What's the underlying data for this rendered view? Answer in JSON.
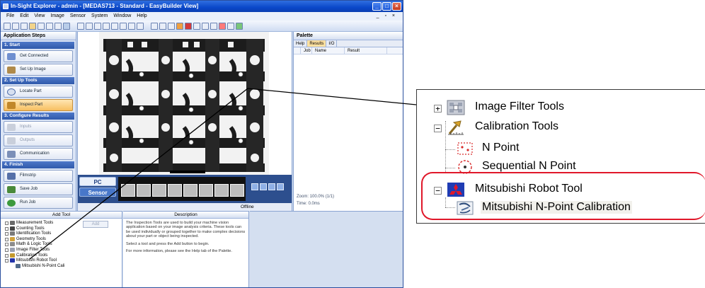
{
  "window": {
    "title": "In-Sight Explorer - admin - [MEDAS713 - Standard - EasyBuilder View]",
    "controls": [
      "_",
      "□",
      "×"
    ]
  },
  "menubar": {
    "items": [
      "File",
      "Edit",
      "View",
      "Image",
      "Sensor",
      "System",
      "Window",
      "Help"
    ],
    "mdi_controls": "_ ▫ ×"
  },
  "steps": {
    "title": "Application Steps",
    "groups": [
      {
        "header": "1. Start",
        "buttons": [
          {
            "label": "Get Connected",
            "state": "normal"
          },
          {
            "label": "Set Up Image",
            "state": "normal"
          }
        ]
      },
      {
        "header": "2. Set Up Tools",
        "buttons": [
          {
            "label": "Locate Part",
            "state": "normal"
          },
          {
            "label": "Inspect Part",
            "state": "active"
          }
        ]
      },
      {
        "header": "3. Configure Results",
        "buttons": [
          {
            "label": "Inputs",
            "state": "disabled"
          },
          {
            "label": "Outputs",
            "state": "disabled"
          },
          {
            "label": "Communication",
            "state": "normal"
          }
        ]
      },
      {
        "header": "4. Finish",
        "buttons": [
          {
            "label": "Filmstrip",
            "state": "normal"
          },
          {
            "label": "Save Job",
            "state": "normal"
          },
          {
            "label": "Run Job",
            "state": "normal"
          }
        ]
      }
    ]
  },
  "filmstrip": {
    "pc_label": "PC",
    "sensor_label": "Sensor",
    "status": "Offline"
  },
  "palette": {
    "title": "Palette",
    "tabs": [
      "Help",
      "Results",
      "I/O"
    ],
    "active_tab": "Results",
    "columns": [
      "",
      "Job",
      "Name",
      "Result"
    ],
    "zoom_text": "Zoom: 100.0% (1/1)",
    "time_text": "Time: 0.0ms"
  },
  "add_tool": {
    "title": "Add Tool",
    "add_label": "Add",
    "tree": [
      {
        "label": "Measurement Tools",
        "level": 0,
        "color": "#6a6a6a"
      },
      {
        "label": "Counting Tools",
        "level": 0,
        "color": "#444444"
      },
      {
        "label": "Identification Tools",
        "level": 0,
        "color": "#7a7a7a"
      },
      {
        "label": "Geometry Tools",
        "level": 0,
        "color": "#d2a23a"
      },
      {
        "label": "Math & Logic Tools",
        "level": 0,
        "color": "#8c8c8c"
      },
      {
        "label": "Image Filter Tools",
        "level": 0,
        "color": "#9aa0b0"
      },
      {
        "label": "Calibration Tools",
        "level": 0,
        "color": "#c59a2c"
      },
      {
        "label": "Mitsubishi Robot Tool",
        "level": 0,
        "color": "#2233aa"
      },
      {
        "label": "Mitsubishi N-Point Cali",
        "level": 1,
        "color": "#506a8a"
      }
    ]
  },
  "description": {
    "title": "Description",
    "paragraphs": [
      "The Inspection Tools are used to build your machine vision application based on your image analysis criteria. These tools can be used individually or grouped together to make complex decisions about your part or object being inspected.",
      "Select a tool and press the Add button to begin.",
      "For more information, please see the Help tab of the Palette."
    ]
  },
  "zoom_tree": {
    "image_filter": "Image Filter Tools",
    "calibration": "Calibration Tools",
    "n_point": "N Point",
    "sequential": "Sequential N Point",
    "robot_tool": "Mitsubishi Robot Tool",
    "robot_calib": "Mitsubishi N-Point Calibration",
    "expanded_symbol": "−",
    "collapsed_symbol": "+"
  },
  "colors": {
    "highlight_border": "#e0182a",
    "title_bar": "#0a47c9",
    "active_step": "#f7bf61"
  }
}
